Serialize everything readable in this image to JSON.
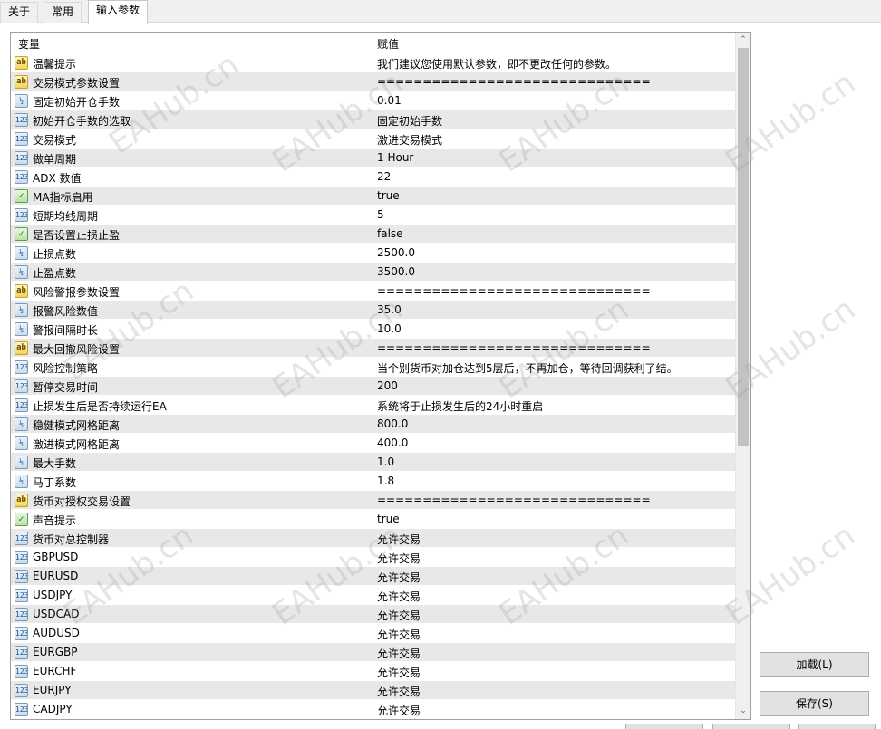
{
  "tabs": [
    {
      "label": "关于"
    },
    {
      "label": "常用"
    },
    {
      "label": "输入参数"
    }
  ],
  "header": {
    "col_variable": "变量",
    "col_value": "赋值"
  },
  "rows": [
    {
      "type": "string",
      "icon_text": "ab",
      "name": "温馨提示",
      "value": "我们建议您使用默认参数，即不更改任何的参数。"
    },
    {
      "type": "string",
      "icon_text": "ab",
      "name": "交易模式参数设置",
      "value": "=============================="
    },
    {
      "type": "double",
      "icon_text": "½",
      "name": "固定初始开仓手数",
      "value": "0.01"
    },
    {
      "type": "enum",
      "icon_text": "123",
      "name": "初始开仓手数的选取",
      "value": "固定初始手数"
    },
    {
      "type": "enum",
      "icon_text": "123",
      "name": "交易模式",
      "value": "激进交易模式"
    },
    {
      "type": "enum",
      "icon_text": "123",
      "name": "做单周期",
      "value": "1 Hour"
    },
    {
      "type": "int",
      "icon_text": "123",
      "name": "ADX 数值",
      "value": "22"
    },
    {
      "type": "bool",
      "icon_text": "✓",
      "name": "MA指标启用",
      "value": "true"
    },
    {
      "type": "int",
      "icon_text": "123",
      "name": "短期均线周期",
      "value": "5"
    },
    {
      "type": "bool",
      "icon_text": "✓",
      "name": "是否设置止损止盈",
      "value": "false"
    },
    {
      "type": "double",
      "icon_text": "½",
      "name": "止损点数",
      "value": "2500.0"
    },
    {
      "type": "double",
      "icon_text": "½",
      "name": "止盈点数",
      "value": "3500.0"
    },
    {
      "type": "string",
      "icon_text": "ab",
      "name": "风险警报参数设置",
      "value": "=============================="
    },
    {
      "type": "double",
      "icon_text": "½",
      "name": "报警风险数值",
      "value": "35.0"
    },
    {
      "type": "double",
      "icon_text": "½",
      "name": "警报间隔时长",
      "value": "10.0"
    },
    {
      "type": "string",
      "icon_text": "ab",
      "name": "最大回撤风险设置",
      "value": "=============================="
    },
    {
      "type": "enum",
      "icon_text": "123",
      "name": "风险控制策略",
      "value": "当个别货币对加仓达到5层后，不再加仓，等待回调获利了结。"
    },
    {
      "type": "int",
      "icon_text": "123",
      "name": "暂停交易时间",
      "value": "200"
    },
    {
      "type": "enum",
      "icon_text": "123",
      "name": "止损发生后是否持续运行EA",
      "value": "系统将于止损发生后的24小时重启"
    },
    {
      "type": "double",
      "icon_text": "½",
      "name": "稳健模式网格距离",
      "value": "800.0"
    },
    {
      "type": "double",
      "icon_text": "½",
      "name": "激进模式网格距离",
      "value": "400.0"
    },
    {
      "type": "double",
      "icon_text": "½",
      "name": "最大手数",
      "value": "1.0"
    },
    {
      "type": "double",
      "icon_text": "½",
      "name": "马丁系数",
      "value": "1.8"
    },
    {
      "type": "string",
      "icon_text": "ab",
      "name": "货币对授权交易设置",
      "value": "=============================="
    },
    {
      "type": "bool",
      "icon_text": "✓",
      "name": "声音提示",
      "value": "true"
    },
    {
      "type": "enum",
      "icon_text": "123",
      "name": "货币对总控制器",
      "value": "允许交易"
    },
    {
      "type": "enum",
      "icon_text": "123",
      "name": "GBPUSD",
      "value": "允许交易"
    },
    {
      "type": "enum",
      "icon_text": "123",
      "name": "EURUSD",
      "value": "允许交易"
    },
    {
      "type": "enum",
      "icon_text": "123",
      "name": "USDJPY",
      "value": "允许交易"
    },
    {
      "type": "enum",
      "icon_text": "123",
      "name": "USDCAD",
      "value": "允许交易"
    },
    {
      "type": "enum",
      "icon_text": "123",
      "name": "AUDUSD",
      "value": "允许交易"
    },
    {
      "type": "enum",
      "icon_text": "123",
      "name": "EURGBP",
      "value": "允许交易"
    },
    {
      "type": "enum",
      "icon_text": "123",
      "name": "EURCHF",
      "value": "允许交易"
    },
    {
      "type": "enum",
      "icon_text": "123",
      "name": "EURJPY",
      "value": "允许交易"
    },
    {
      "type": "enum",
      "icon_text": "123",
      "name": "CADJPY",
      "value": "允许交易"
    }
  ],
  "buttons": {
    "load": "加载(L)",
    "save": "保存(S)"
  },
  "scrollbar": {
    "up_glyph": "⌃",
    "down_glyph": "⌄"
  },
  "watermark": {
    "text": "EAHub.cn"
  },
  "colors": {
    "row_alt": "#e8e8e8",
    "button_bg": "#e1e1e1",
    "border": "#a0a0a0"
  }
}
